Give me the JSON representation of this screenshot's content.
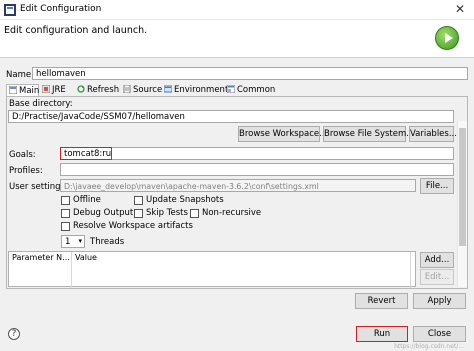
{
  "window": {
    "title": "Edit Configuration",
    "close_glyph": "✕",
    "heading": "Edit configuration and launch."
  },
  "name_field": {
    "label": "Name:",
    "value": "hellomaven"
  },
  "tabs": [
    {
      "label": "Main",
      "icon": "main-icon"
    },
    {
      "label": "JRE",
      "icon": "jre-icon"
    },
    {
      "label": "Refresh",
      "icon": "refresh-icon"
    },
    {
      "label": "Source",
      "icon": "source-icon"
    },
    {
      "label": "Environment",
      "icon": "environment-icon"
    },
    {
      "label": "Common",
      "icon": "common-icon"
    }
  ],
  "main": {
    "base_directory_label": "Base directory:",
    "base_directory_value": "D:/Practise/JavaCode/SSM07/hellomaven",
    "browse_workspace_label": "Browse Workspace...",
    "browse_filesystem_label": "Browse File System...",
    "variables_label": "Variables...",
    "goals_label": "Goals:",
    "goals_value": "tomcat8:run",
    "profiles_label": "Profiles:",
    "profiles_value": "",
    "user_settings_label": "User settings:",
    "user_settings_value": "D:\\javaee_develop\\maven\\apache-maven-3.6.2\\conf\\settings.xml",
    "file_button_label": "File...",
    "checkboxes": {
      "offline": "Offline",
      "update_snapshots": "Update Snapshots",
      "debug_output": "Debug Output",
      "skip_tests": "Skip Tests",
      "non_recursive": "Non-recursive",
      "resolve_workspace": "Resolve Workspace artifacts"
    },
    "threads_value": "1",
    "threads_label": "Threads",
    "table": {
      "columns": [
        "Parameter N...",
        "Value"
      ]
    },
    "add_label": "Add...",
    "edit_label": "Edit..."
  },
  "footer": {
    "revert_label": "Revert",
    "apply_label": "Apply",
    "run_label": "Run",
    "close_label": "Close",
    "help_glyph": "?"
  },
  "watermark": "https://blog.csdn.net/..."
}
